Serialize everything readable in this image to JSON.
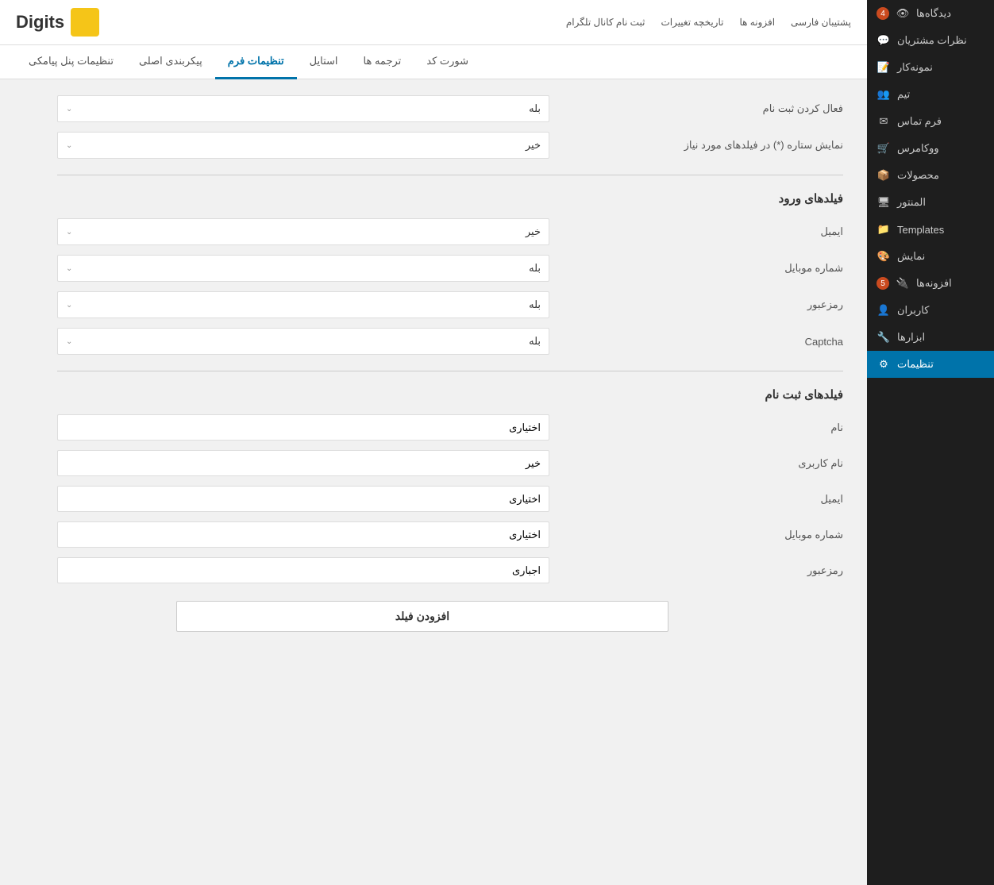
{
  "logo": {
    "text": "Digits"
  },
  "top_nav": {
    "items": [
      {
        "label": "پشتیبان فارسی"
      },
      {
        "label": "افزونه ها"
      },
      {
        "label": "تاریخچه تغییرات"
      },
      {
        "label": "ثبت نام کانال تلگرام"
      }
    ]
  },
  "tabs": [
    {
      "label": "تنظیمات پنل پیامکی",
      "active": false
    },
    {
      "label": "پیکربندی اصلی",
      "active": false
    },
    {
      "label": "تنظیمات فرم",
      "active": true
    },
    {
      "label": "استایل",
      "active": false
    },
    {
      "label": "ترجمه ها",
      "active": false
    },
    {
      "label": "شورت کد",
      "active": false
    }
  ],
  "form_rows": [
    {
      "label": "فعال کردن ثبت نام",
      "value": "بله"
    },
    {
      "label": "نمایش ستاره (*) در فیلدهای مورد نیاز",
      "value": "خیر"
    }
  ],
  "input_fields_section": {
    "title": "فیلدهای ورود",
    "rows": [
      {
        "label": "ایمیل",
        "value": "خیر"
      },
      {
        "label": "شماره موبایل",
        "value": "بله"
      },
      {
        "label": "رمزعبور",
        "value": "بله"
      },
      {
        "label": "Captcha",
        "value": "بله"
      }
    ]
  },
  "registration_fields_section": {
    "title": "فیلدهای ثبت نام",
    "rows": [
      {
        "label": "نام",
        "value": "اختیاری"
      },
      {
        "label": "نام کاربری",
        "value": "خیر"
      },
      {
        "label": "ایمیل",
        "value": "اختیاری"
      },
      {
        "label": "شماره موبایل",
        "value": "اختیاری"
      },
      {
        "label": "رمزعبور",
        "value": "اجباری"
      }
    ],
    "add_button": "افزودن فیلد"
  },
  "sidebar": {
    "items": [
      {
        "label": "دیدگاه‌ها",
        "icon": "eye-icon",
        "badge": "4",
        "active": false
      },
      {
        "label": "نظرات مشتریان",
        "icon": "comments-icon",
        "badge": null,
        "active": false
      },
      {
        "label": "نمونه‌کار",
        "icon": "sample-icon",
        "badge": null,
        "active": false
      },
      {
        "label": "تیم",
        "icon": "team-icon",
        "badge": null,
        "active": false
      },
      {
        "label": "فرم تماس",
        "icon": "contact-icon",
        "badge": null,
        "active": false
      },
      {
        "label": "ووکامرس",
        "icon": "woo-icon",
        "badge": null,
        "active": false
      },
      {
        "label": "محصولات",
        "icon": "products-icon",
        "badge": null,
        "active": false
      },
      {
        "label": "المنتور",
        "icon": "monitor-icon",
        "badge": null,
        "active": false
      },
      {
        "label": "Templates",
        "icon": "templates-icon",
        "badge": null,
        "active": false
      },
      {
        "label": "نمایش",
        "icon": "display-icon",
        "badge": null,
        "active": false
      },
      {
        "label": "افزونه‌ها",
        "icon": "plugins-icon",
        "badge": "5",
        "active": false
      },
      {
        "label": "کاربران",
        "icon": "users-icon",
        "badge": null,
        "active": false
      },
      {
        "label": "ابزارها",
        "icon": "tools-icon",
        "badge": null,
        "active": false
      },
      {
        "label": "تنظیمات",
        "icon": "settings-icon",
        "badge": null,
        "active": true
      }
    ]
  }
}
